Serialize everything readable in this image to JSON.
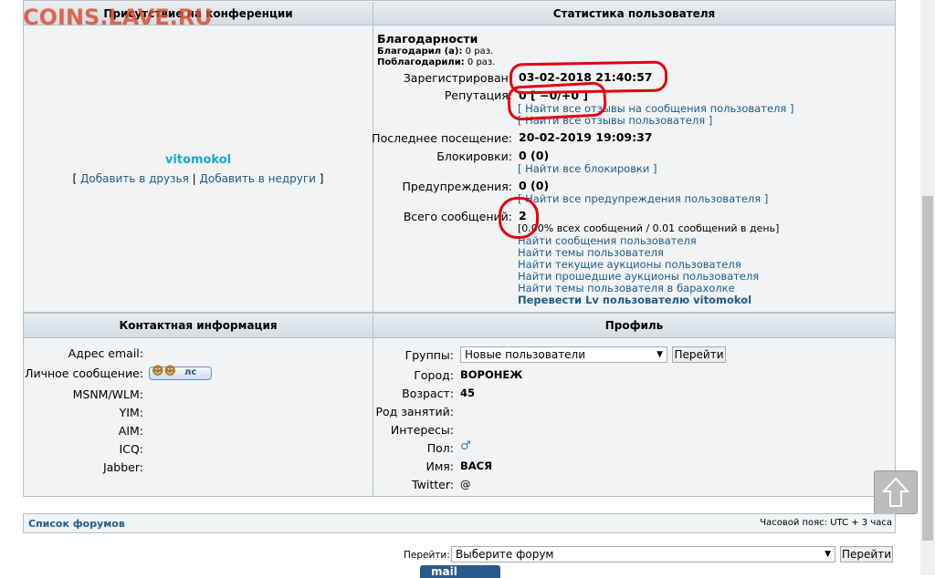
{
  "watermark": "COINS.LAVE.RU",
  "presence": {
    "header": "Присутствие на конференции",
    "username": "vitomokol",
    "bracket_open": "[",
    "add_friend": "Добавить в друзья",
    "separator": "|",
    "add_enemy": "Добавить в недруги",
    "bracket_close": "]"
  },
  "stats": {
    "header": "Статистика пользователя",
    "thanks_title": "Благодарности",
    "thanked_label": "Благодарил (а):",
    "thanked_value": "0 раз.",
    "got_thanks_label": "Поблагодарили:",
    "got_thanks_value": "0 раз.",
    "registered_label": "Зарегистрирован:",
    "registered_value": "03-02-2018 21:40:57",
    "reputation_label": "Репутация:",
    "reputation_value": "0 [ −0/+0 ]",
    "rep_link1": "[ Найти все отзывы на сообщения пользователя ]",
    "rep_link2": "[ Найти все отзывы пользователя ]",
    "last_visit_label": "Последнее посещение:",
    "last_visit_value": "20-02-2019 19:09:37",
    "bans_label": "Блокировки:",
    "bans_value": "0 (0)",
    "bans_link": "[ Найти все блокировки ]",
    "warnings_label": "Предупреждения:",
    "warnings_value": "0 (0)",
    "warnings_link": "[ Найти все предупреждения пользователя ]",
    "posts_label": "Всего сообщений:",
    "posts_value": "2",
    "posts_detail": "[0.00% всех сообщений / 0.01 сообщений в день]",
    "links": [
      "Найти сообщения пользователя",
      "Найти темы пользователя",
      "Найти текущие аукционы пользователя",
      "Найти прошедшие аукционы пользователя",
      "Найти темы пользователя в барахолке"
    ],
    "transfer_link": "Перевести Lv пользователю vitomokol"
  },
  "contact": {
    "header": "Контактная информация",
    "email_label": "Адрес email:",
    "pm_label": "Личное сообщение:",
    "pm_button": "лс",
    "msnm_label": "MSNM/WLM:",
    "yim_label": "YIM:",
    "aim_label": "AIM:",
    "icq_label": "ICQ:",
    "jabber_label": "Jabber:"
  },
  "profile": {
    "header": "Профиль",
    "groups_label": "Группы:",
    "groups_value": "Новые пользователи",
    "go_button": "Перейти",
    "city_label": "Город:",
    "city_value": "ВОРОНЕЖ",
    "age_label": "Возраст:",
    "age_value": "45",
    "occupation_label": "Род занятий:",
    "interests_label": "Интересы:",
    "gender_label": "Пол:",
    "gender_icon": "male-symbol-icon",
    "name_label": "Имя:",
    "name_value": "ВАСЯ",
    "twitter_label": "Twitter:",
    "twitter_value": "@"
  },
  "footer": {
    "forum_list": "Список форумов",
    "timezone": "Часовой пояс: UTC + 3 часа",
    "jump_label": "Перейти:",
    "jump_select": "Выберите форум",
    "jump_button": "Перейти",
    "mail_logo": "mail"
  },
  "colors": {
    "link": "#1e5c8a",
    "username": "#19a8d6",
    "header_bg": "#dde3e7",
    "cell_bg": "#f1f3f4",
    "annotation": "#e3000f"
  },
  "scroll_up_icon": "arrow-up-icon"
}
